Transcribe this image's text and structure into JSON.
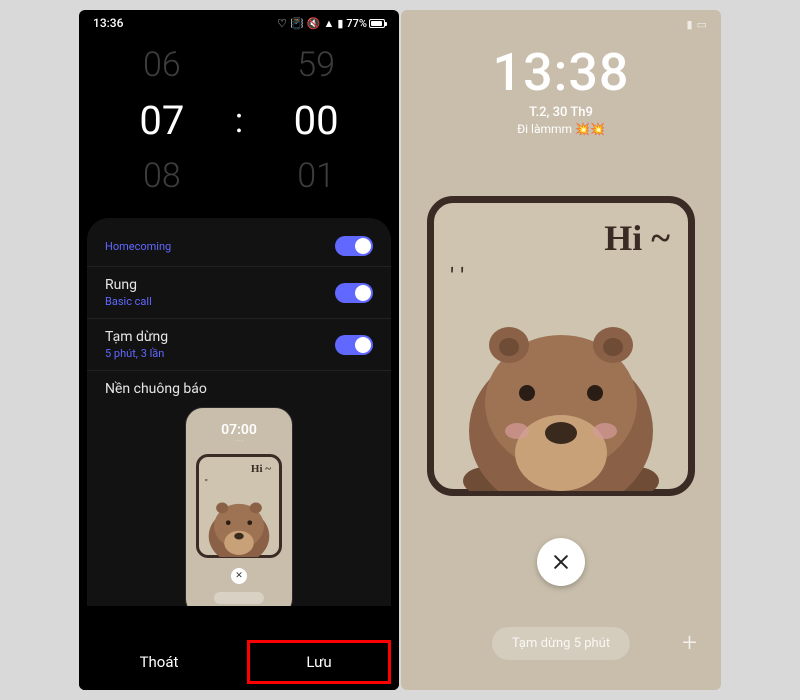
{
  "left": {
    "status": {
      "time": "13:36",
      "battery_text": "77%"
    },
    "picker": {
      "hour_prev": "06",
      "hour": "07",
      "hour_next": "08",
      "colon": ":",
      "min_prev": "59",
      "min": "00",
      "min_next": "01"
    },
    "rows": {
      "sound": {
        "title": "",
        "sub": "Homecoming"
      },
      "vibrate": {
        "title": "Rung",
        "sub": "Basic call"
      },
      "snooze": {
        "title": "Tạm dừng",
        "sub": "5 phút, 3 lần"
      }
    },
    "bg_label": "Nền chuông báo",
    "mini": {
      "time": "07:00",
      "sub": "· · ·"
    },
    "footer": {
      "exit": "Thoát",
      "save": "Lưu"
    }
  },
  "right": {
    "clock": {
      "time": "13:38",
      "date": "T.2, 30 Th9",
      "reminder": "Đi làmmm 💥💥"
    },
    "hi": "Hi ~",
    "snooze": "Tạm dừng 5 phút",
    "plus": "+"
  }
}
